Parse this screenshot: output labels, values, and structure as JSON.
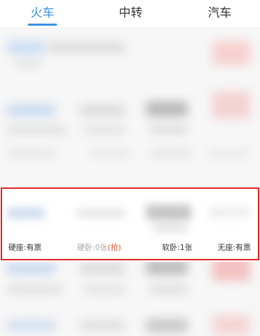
{
  "tabs": [
    {
      "label": "火车",
      "active": true
    },
    {
      "label": "中转",
      "active": false
    },
    {
      "label": "汽车",
      "active": false
    }
  ],
  "colors": {
    "accent": "#3a8ee6",
    "highlight": "#e02020",
    "grab": "#e05a3a"
  },
  "seat_info": {
    "hard_seat": "硬座:有票",
    "hard_sleeper": "硬卧:0张",
    "hard_sleeper_action": "(抢)",
    "soft_sleeper": "软卧:1张",
    "no_seat": "无座:有票"
  }
}
